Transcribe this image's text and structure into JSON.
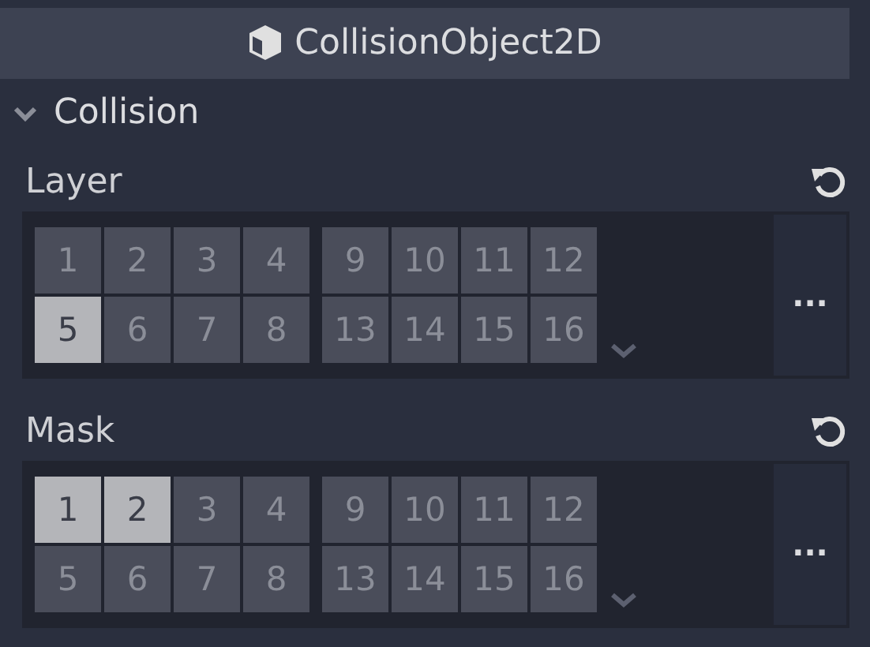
{
  "header": {
    "title": "CollisionObject2D"
  },
  "section": {
    "title": "Collision",
    "expanded": true
  },
  "properties": [
    {
      "label": "Layer",
      "more": "...",
      "bits": [
        {
          "label": "1",
          "selected": false
        },
        {
          "label": "2",
          "selected": false
        },
        {
          "label": "3",
          "selected": false
        },
        {
          "label": "4",
          "selected": false
        },
        {
          "label": "9",
          "selected": false
        },
        {
          "label": "10",
          "selected": false
        },
        {
          "label": "11",
          "selected": false
        },
        {
          "label": "12",
          "selected": false
        },
        {
          "label": "5",
          "selected": true
        },
        {
          "label": "6",
          "selected": false
        },
        {
          "label": "7",
          "selected": false
        },
        {
          "label": "8",
          "selected": false
        },
        {
          "label": "13",
          "selected": false
        },
        {
          "label": "14",
          "selected": false
        },
        {
          "label": "15",
          "selected": false
        },
        {
          "label": "16",
          "selected": false
        }
      ]
    },
    {
      "label": "Mask",
      "more": "...",
      "bits": [
        {
          "label": "1",
          "selected": true
        },
        {
          "label": "2",
          "selected": true
        },
        {
          "label": "3",
          "selected": false
        },
        {
          "label": "4",
          "selected": false
        },
        {
          "label": "9",
          "selected": false
        },
        {
          "label": "10",
          "selected": false
        },
        {
          "label": "11",
          "selected": false
        },
        {
          "label": "12",
          "selected": false
        },
        {
          "label": "5",
          "selected": false
        },
        {
          "label": "6",
          "selected": false
        },
        {
          "label": "7",
          "selected": false
        },
        {
          "label": "8",
          "selected": false
        },
        {
          "label": "13",
          "selected": false
        },
        {
          "label": "14",
          "selected": false
        },
        {
          "label": "15",
          "selected": false
        },
        {
          "label": "16",
          "selected": false
        }
      ]
    }
  ]
}
